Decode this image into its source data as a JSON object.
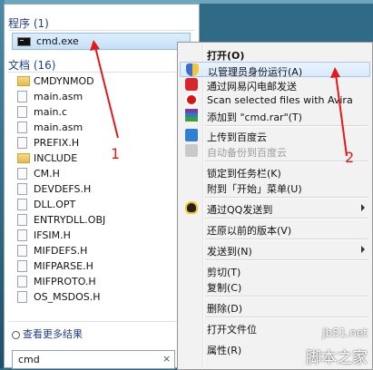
{
  "start_menu": {
    "programs_header": "程序 (1)",
    "program_item": "cmd.exe",
    "documents_header": "文档 (16)",
    "documents": [
      {
        "name": "CMDYNMOD",
        "type": "folder"
      },
      {
        "name": "main.asm",
        "type": "file"
      },
      {
        "name": "main.c",
        "type": "file"
      },
      {
        "name": "main.asm",
        "type": "file"
      },
      {
        "name": "PREFIX.H",
        "type": "file"
      },
      {
        "name": "INCLUDE",
        "type": "folder"
      },
      {
        "name": "CM.H",
        "type": "file"
      },
      {
        "name": "DEVDEFS.H",
        "type": "file"
      },
      {
        "name": "DLL.OPT",
        "type": "file"
      },
      {
        "name": "ENTRYDLL.OBJ",
        "type": "file"
      },
      {
        "name": "IFSIM.H",
        "type": "file"
      },
      {
        "name": "MIFDEFS.H",
        "type": "file"
      },
      {
        "name": "MIFPARSE.H",
        "type": "file"
      },
      {
        "name": "MIFPROTO.H",
        "type": "file"
      },
      {
        "name": "OS_MSDOS.H",
        "type": "file"
      }
    ],
    "see_more": "查看更多结果",
    "search_value": "cmd",
    "clear_glyph": "×"
  },
  "context_menu": {
    "items": [
      {
        "label": "打开(O)",
        "icon": "",
        "bold": true
      },
      {
        "label": "以管理员身份运行(A)",
        "icon": "shield-icon",
        "highlight": true
      },
      {
        "label": "通过网易闪电邮发送",
        "icon": "netease-icon"
      },
      {
        "label": "Scan selected files with Avira",
        "icon": "avira-icon"
      },
      {
        "label": "添加到 \"cmd.rar\"(T)",
        "icon": "rar-icon"
      },
      {
        "label": "上传到百度云",
        "icon": "cloud-icon"
      },
      {
        "label": "自动备份到百度云",
        "icon": "cloud-disabled-icon",
        "disabled": true
      },
      {
        "label": "锁定到任务栏(K)",
        "icon": ""
      },
      {
        "label": "附到「开始」菜单(U)",
        "icon": ""
      },
      {
        "label": "通过QQ发送到",
        "icon": "qq-icon",
        "submenu": true
      },
      {
        "label": "还原以前的版本(V)",
        "icon": ""
      },
      {
        "label": "发送到(N)",
        "icon": "",
        "submenu": true
      },
      {
        "label": "剪切(T)",
        "icon": ""
      },
      {
        "label": "复制(C)",
        "icon": ""
      },
      {
        "label": "删除(D)",
        "icon": ""
      },
      {
        "label": "打开文件位",
        "icon": ""
      },
      {
        "label": "属性(R)",
        "icon": ""
      }
    ]
  },
  "annotations": {
    "label_1": "1",
    "label_2": "2",
    "arrow_color": "#e21a1a"
  },
  "watermark": {
    "site": "jb51.net",
    "brand": "脚本之家"
  }
}
